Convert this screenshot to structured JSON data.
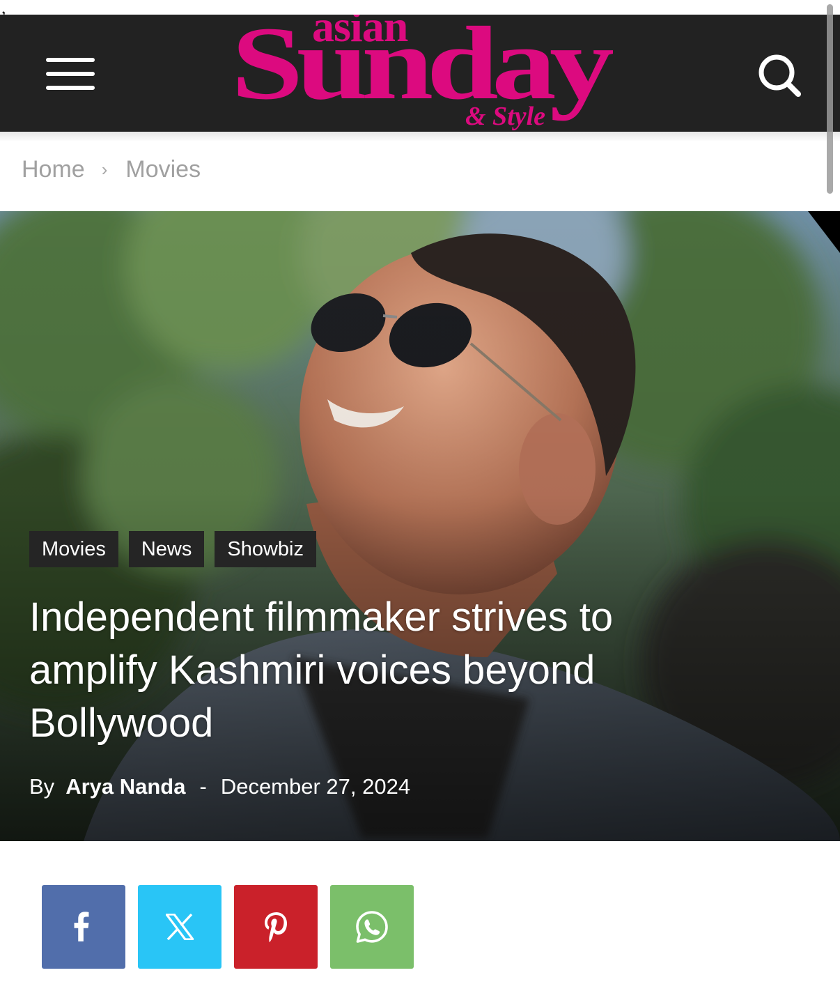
{
  "colors": {
    "header_bg": "#222222",
    "brand_pink": "#dc0a7f",
    "facebook": "#516eab",
    "twitter_x": "#29c5f6",
    "pinterest": "#ca212a",
    "whatsapp": "#7bbf6a"
  },
  "header": {
    "menu_icon": "hamburger-menu-icon",
    "search_icon": "search-icon",
    "logo": {
      "line1": "asian",
      "line2": "Sunday",
      "line3": "& Style"
    }
  },
  "breadcrumb": {
    "home": "Home",
    "separator": "›",
    "current": "Movies"
  },
  "article": {
    "categories": [
      "Movies",
      "News",
      "Showbiz"
    ],
    "title": "Independent filmmaker strives to amplify Kashmiri voices beyond Bollywood",
    "by_label": "By",
    "author": "Arya Nanda",
    "dash": "-",
    "date": "December 27, 2024"
  },
  "share": {
    "buttons": [
      {
        "name": "facebook",
        "icon": "facebook-icon"
      },
      {
        "name": "x",
        "icon": "x-icon"
      },
      {
        "name": "pinterest",
        "icon": "pinterest-icon"
      },
      {
        "name": "whatsapp",
        "icon": "whatsapp-icon"
      }
    ]
  }
}
